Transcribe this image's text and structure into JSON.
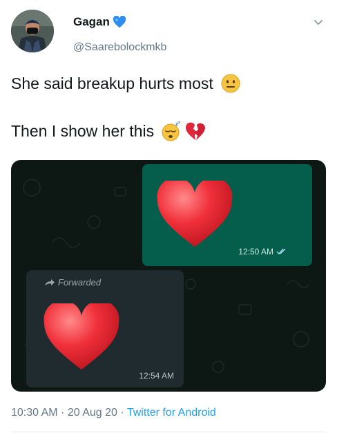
{
  "user": {
    "name": "Gagan",
    "handle": "@Saarebolockmkb",
    "verified_icon": "blue-heart-icon"
  },
  "tweet": {
    "line1": "She said breakup hurts most",
    "line1_emoji": "neutral-face-icon",
    "line2": "Then I show her this",
    "line2_emojis": [
      "sleeping-face-icon",
      "broken-heart-icon"
    ]
  },
  "media": {
    "outgoing_time": "12:50 AM",
    "incoming_forwarded": "Forwarded",
    "incoming_time": "12:54 AM"
  },
  "meta": {
    "time": "10:30 AM",
    "date": "20 Aug 20",
    "source": "Twitter for Android",
    "sep": "·"
  },
  "colors": {
    "accent": "#1da1f2",
    "text": "#14171a",
    "muted": "#657786",
    "chat_bg": "#0d1714",
    "bubble_out": "#055e4b",
    "bubble_in": "#1f2b2f"
  }
}
